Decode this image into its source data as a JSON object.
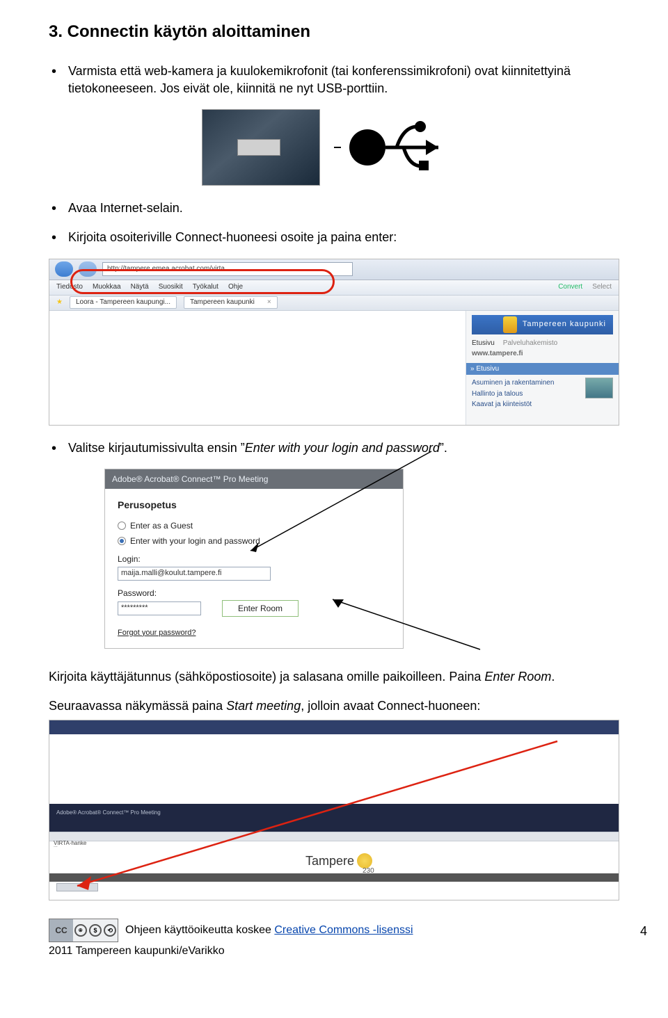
{
  "heading": "3. Connectin käytön aloittaminen",
  "bullets": {
    "b1": "Varmista että web-kamera ja kuulokemikrofonit (tai konferenssimikrofoni) ovat kiinnitettyinä tietokoneeseen. Jos eivät ole, kiinnitä ne nyt USB-porttiin.",
    "b2": "Avaa Internet-selain.",
    "b3": "Kirjoita osoiteriville Connect-huoneesi osoite ja paina enter:",
    "b4_a": "Valitse kirjautumissivulta ensin ”",
    "b4_i": "Enter with your login and password",
    "b4_b": "”."
  },
  "browser": {
    "url": "http://tampere.emea.acrobat.com/virta",
    "menu": {
      "tiedosto": "Tiedosto",
      "muokkaa": "Muokkaa",
      "nayta": "Näytä",
      "suosikit": "Suosikit",
      "tyokalut": "Työkalut",
      "ohje": "Ohje",
      "convert": "Convert",
      "select": "Select"
    },
    "tabs": {
      "t1": "Loora - Tampereen kaupungi...",
      "t2": "Tampereen kaupunki"
    },
    "banner": "Tampereen kaupunki",
    "side": {
      "etusivu": "Etusivu",
      "palvelu": "Palveluhakemisto",
      "www": "www.tampere.fi",
      "head": "» Etusivu",
      "l1": "Asuminen ja rakentaminen",
      "l2": "Hallinto ja talous",
      "l3": "Kaavat ja kiinteistöt"
    }
  },
  "login": {
    "header": "Adobe® Acrobat® Connect™ Pro Meeting",
    "title": "Perusopetus",
    "opt1": "Enter as a Guest",
    "opt2": "Enter with your login and password",
    "login_lbl": "Login:",
    "login_val": "maija.malli@koulut.tampere.fi",
    "pw_lbl": "Password:",
    "pw_val": "*********",
    "enter": "Enter Room",
    "forgot": "Forgot your password?"
  },
  "after_login_a": "Kirjoita käyttäjätunnus (sähköpostiosoite) ja salasana omille paikoilleen. Paina ",
  "after_login_i": "Enter Room",
  "after_login_b": ".",
  "next_a": "Seuraavassa näkymässä paina ",
  "next_i": "Start meeting",
  "next_b": ", jolloin avaat Connect-huoneen:",
  "start": {
    "acp": "Adobe® Acrobat® Connect™ Pro Meeting",
    "virta": "VIRTA-hanke",
    "tampere": "Tampere",
    "y": "230"
  },
  "footer": {
    "text_a": "Ohjeen käyttöoikeutta koskee ",
    "link": "Creative Commons -lisenssi",
    "line2": "2011 Tampereen kaupunki/eVarikko",
    "page": "4"
  }
}
